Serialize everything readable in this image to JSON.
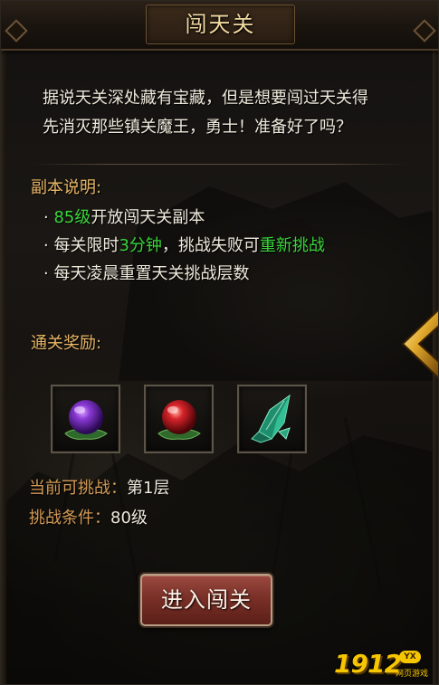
{
  "window": {
    "title": "闯天关"
  },
  "intro": {
    "line1": "据说天关深处藏有宝藏，但是想要闯过天关得",
    "line2": "先消灭那些镇关魔王，勇士！准备好了吗？"
  },
  "description": {
    "heading": "副本说明:",
    "rule1": {
      "bullet": "·",
      "level": "85级",
      "text": "开放闯天关副本"
    },
    "rule2": {
      "bullet": "·",
      "prefix": "每关限时",
      "time": "3分钟",
      "middle": "，挑战失败可",
      "retry": "重新挑战"
    },
    "rule3": {
      "bullet": "·",
      "text": "每天凌晨重置天关挑战层数"
    }
  },
  "rewards": {
    "heading": "通关奖励:",
    "items": [
      {
        "icon": "purple-orb-icon"
      },
      {
        "icon": "red-orb-icon"
      },
      {
        "icon": "green-crystal-icon"
      }
    ]
  },
  "status": {
    "current_label": "当前可挑战：",
    "current_value": "第1层",
    "condition_label": "挑战条件：",
    "condition_value": "80级"
  },
  "enter_button": {
    "label": "进入闯关"
  },
  "watermark": {
    "number": "1912",
    "badge": "YX",
    "sub": "网页游戏"
  },
  "colors": {
    "accent_gold": "#e7b665",
    "highlight_green": "#39d53a",
    "label_orange": "#d39a55",
    "button_red": "#7a3027"
  }
}
